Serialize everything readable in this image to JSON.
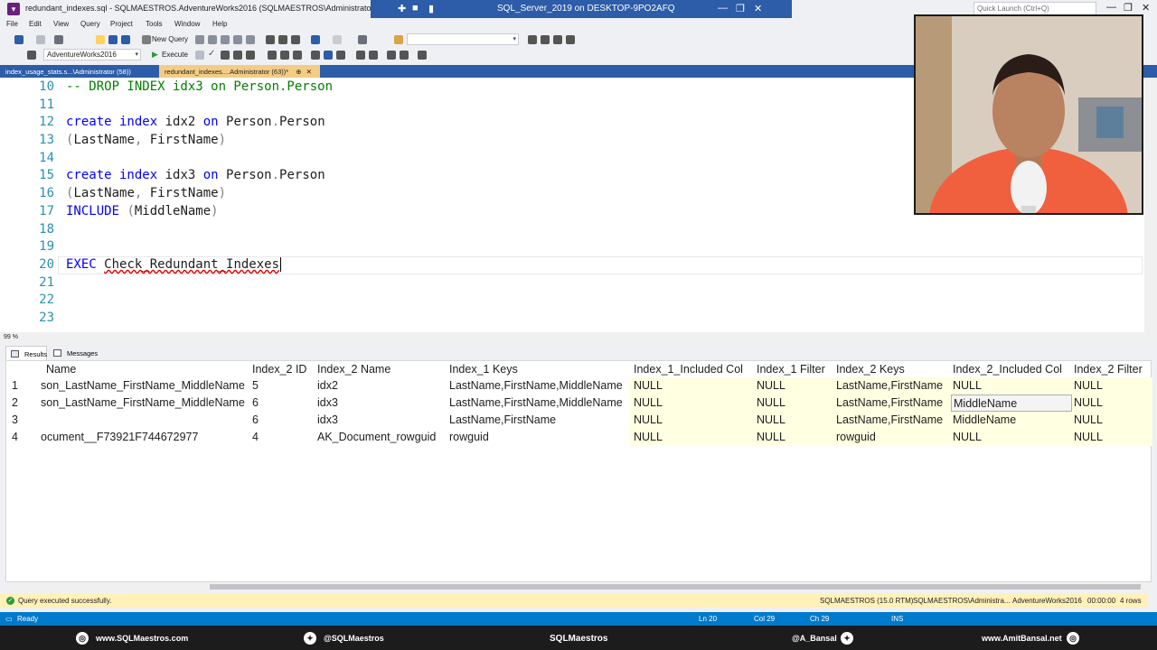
{
  "window": {
    "title": "redundant_indexes.sql - SQLMAESTROS.AdventureWorks2016 (SQLMAESTROS\\Administrator (63))* - Microsoft",
    "server_label": "SQL_Server_2019 on DESKTOP-9PO2AFQ",
    "quick_launch_placeholder": "Quick Launch (Ctrl+Q)",
    "minimize": "—",
    "restore": "❐",
    "close": "✕"
  },
  "menu": [
    "File",
    "Edit",
    "View",
    "Query",
    "Project",
    "Tools",
    "Window",
    "Help"
  ],
  "toolbar": {
    "new_query": "New Query",
    "database": "AdventureWorks2016",
    "execute": "Execute"
  },
  "doc_tabs": [
    {
      "label": "index_usage_stats.s...\\Administrator (58))"
    },
    {
      "label": "redundant_indexes....Administrator (63))*",
      "pin": "⊕",
      "close": "✕"
    }
  ],
  "editor": {
    "lines": [
      {
        "n": "10",
        "text": "-- DROP INDEX idx3 on Person.Person"
      },
      {
        "n": "11"
      },
      {
        "n": "12",
        "kw1": "create index",
        "mid": " idx2 ",
        "kw2": "on",
        "rest": " Person",
        "dot": ".",
        "tail": "Person"
      },
      {
        "n": "13",
        "p1": "(",
        "mid": "LastName",
        "comma": ",",
        "rest": " FirstName",
        "p2": ")"
      },
      {
        "n": "14"
      },
      {
        "n": "15",
        "kw1": "create index",
        "mid": " idx3 ",
        "kw2": "on",
        "rest": " Person",
        "dot": ".",
        "tail": "Person"
      },
      {
        "n": "16",
        "p1": "(",
        "mid": "LastName",
        "comma": ",",
        "rest": " FirstName",
        "p2": ")"
      },
      {
        "n": "17",
        "kw1": "INCLUDE",
        "p1": " (",
        "mid": "MiddleName",
        "p2": ")"
      },
      {
        "n": "18"
      },
      {
        "n": "19"
      },
      {
        "n": "20",
        "kw1": "EXEC",
        "mid": " ",
        "rest": "Check_Redundant_Indexes"
      },
      {
        "n": "21"
      },
      {
        "n": "22"
      },
      {
        "n": "23"
      }
    ],
    "zoom": "99 %"
  },
  "result_tabs": {
    "results": "Results",
    "messages": "Messages"
  },
  "grid": {
    "columns": [
      "Name",
      "Index_2 ID",
      "Index_2 Name",
      "Index_1 Keys",
      "Index_1_Included Col",
      "Index_1 Filter",
      "Index_2 Keys",
      "Index_2_Included Col",
      "Index_2 Filter"
    ],
    "rows": [
      [
        "1",
        "son_LastName_FirstName_MiddleName",
        "5",
        "idx2",
        "LastName,FirstName,MiddleName",
        "NULL",
        "NULL",
        "LastName,FirstName",
        "NULL",
        "NULL"
      ],
      [
        "2",
        "son_LastName_FirstName_MiddleName",
        "6",
        "idx3",
        "LastName,FirstName,MiddleName",
        "NULL",
        "NULL",
        "LastName,FirstName",
        "MiddleName",
        "NULL"
      ],
      [
        "3",
        "",
        "6",
        "idx3",
        "LastName,FirstName",
        "NULL",
        "NULL",
        "LastName,FirstName",
        "MiddleName",
        "NULL"
      ],
      [
        "4",
        "ocument__F73921F744672977",
        "4",
        "AK_Document_rowguid",
        "rowguid",
        "NULL",
        "NULL",
        "rowguid",
        "NULL",
        "NULL"
      ]
    ]
  },
  "query_status": {
    "message": "Query executed successfully.",
    "server": "SQLMAESTROS (15.0 RTM)",
    "user": "SQLMAESTROS\\Administra...",
    "db": "AdventureWorks2016",
    "time": "00:00:00",
    "rows": "4 rows"
  },
  "statusbar": {
    "ready": "Ready",
    "ln": "Ln 20",
    "col": "Col 29",
    "ch": "Ch 29",
    "ins": "INS"
  },
  "footer": {
    "site1": "www.SQLMaestros.com",
    "twitter1": "@SQLMaestros",
    "brand": "SQLMaestros",
    "twitter2": "@A_Bansal",
    "site2": "www.AmitBansal.net"
  },
  "colors": {
    "accent": "#007acc",
    "tab_active": "#f5cc84",
    "keyword": "#0000ff",
    "comment": "#008000",
    "line_number": "#2b91af"
  }
}
